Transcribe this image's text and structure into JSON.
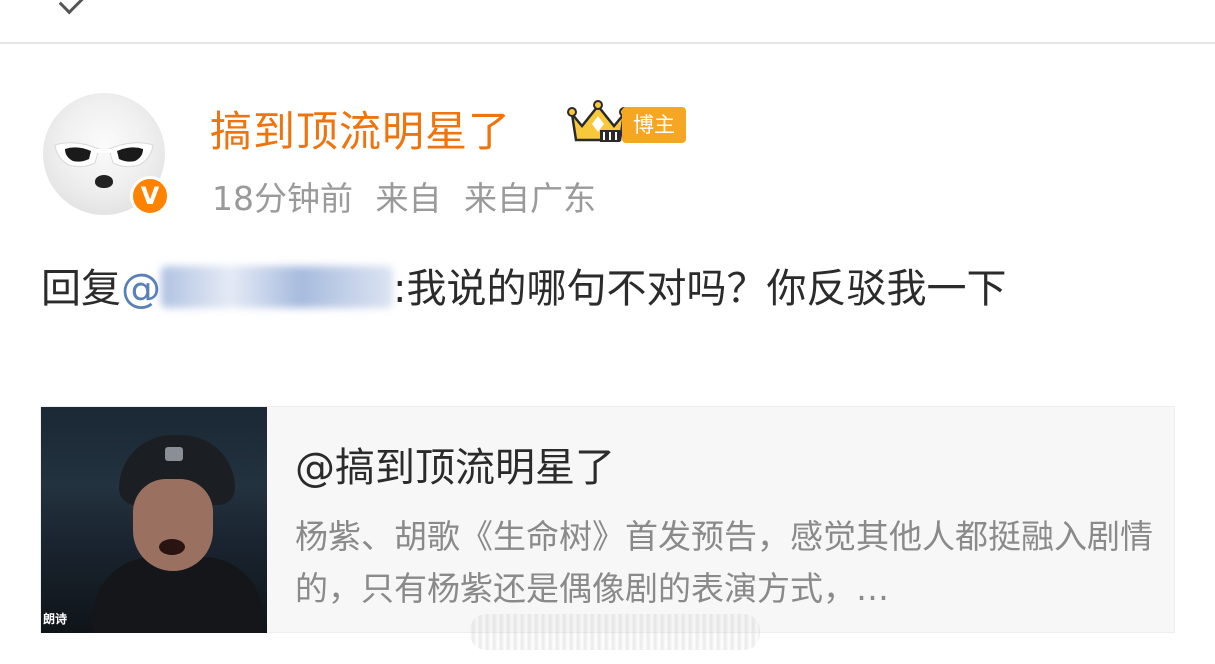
{
  "post": {
    "author": "搞到顶流明星了",
    "badge_label": "博主",
    "verified_glyph": "V",
    "time": "18分钟前",
    "source": "来自 来自广东",
    "text_prefix": "回复",
    "mention_at": "@",
    "mention_visible_tail": "",
    "text_body": ":我说的哪句不对吗？你反驳我一下"
  },
  "card": {
    "title": "@搞到顶流明星了",
    "desc": "杨紫、胡歌《生命树》首发预告，感觉其他人都挺融入剧情的，只有杨紫还是偶像剧的表演方式，…",
    "thumb_caption": "朗诗"
  },
  "icons": {
    "back": "chevron-left-icon",
    "verified": "verified-v-icon",
    "crown": "crown-level-icon"
  },
  "colors": {
    "author": "#f0740e",
    "mention": "#5a80b8",
    "badge_bg": "#f5a623"
  }
}
